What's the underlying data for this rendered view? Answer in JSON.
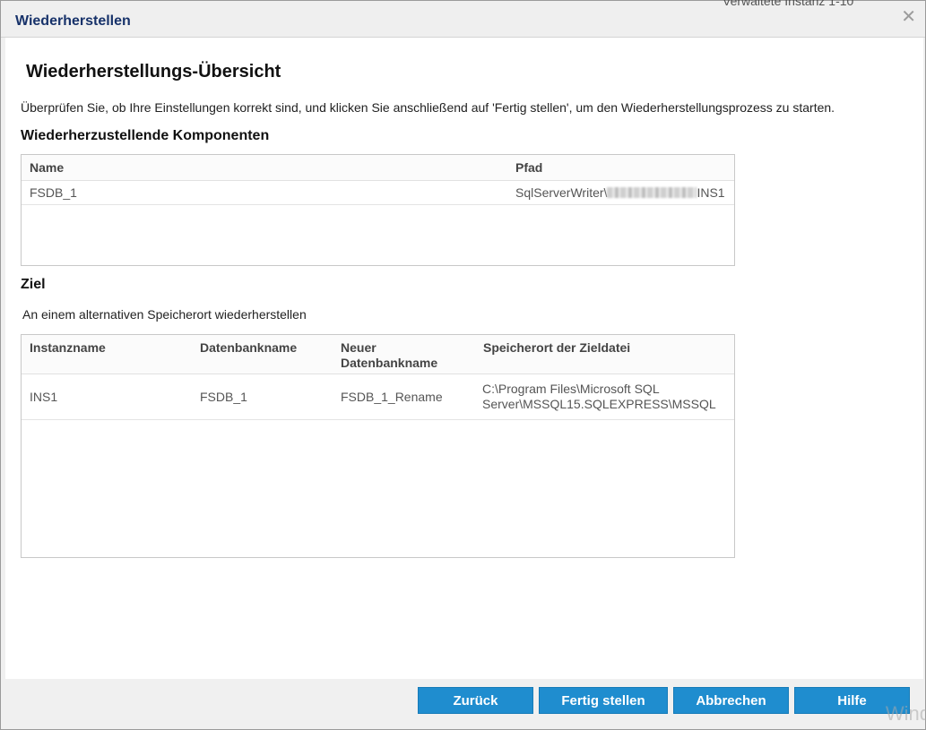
{
  "dialog": {
    "title": "Wiederherstellen",
    "close_icon": "close-icon"
  },
  "background_text": "Verwaltete Instanz 1-10",
  "summary": {
    "heading": "Wiederherstellungs-Übersicht",
    "instruction": "Überprüfen Sie, ob Ihre Einstellungen korrekt sind, und klicken Sie anschließend auf 'Fertig stellen', um den Wiederherstellungsprozess zu starten."
  },
  "components": {
    "heading": "Wiederherzustellende Komponenten",
    "columns": [
      "Name",
      "Pfad"
    ],
    "rows": [
      {
        "name": "FSDB_1",
        "path_prefix": "SqlServerWriter\\",
        "path_suffix": "INS1"
      }
    ]
  },
  "target": {
    "heading": "Ziel",
    "mode": "An einem alternativen Speicherort wiederherstellen",
    "columns": [
      "Instanzname",
      "Datenbankname",
      "Neuer Datenbankname",
      "Speicherort der Zieldatei"
    ],
    "rows": [
      {
        "instance": "INS1",
        "database": "FSDB_1",
        "new_database": "FSDB_1_Rename",
        "location_line1": "C:\\Program Files\\Microsoft SQL",
        "location_line2": "Server\\MSSQL15.SQLEXPRESS\\MSSQL"
      }
    ]
  },
  "buttons": {
    "back": "Zurück",
    "finish": "Fertig stellen",
    "cancel": "Abbrechen",
    "help": "Hilfe"
  },
  "watermark": "Wind",
  "colors": {
    "title": "#17326a",
    "button": "#1f8dcf"
  }
}
